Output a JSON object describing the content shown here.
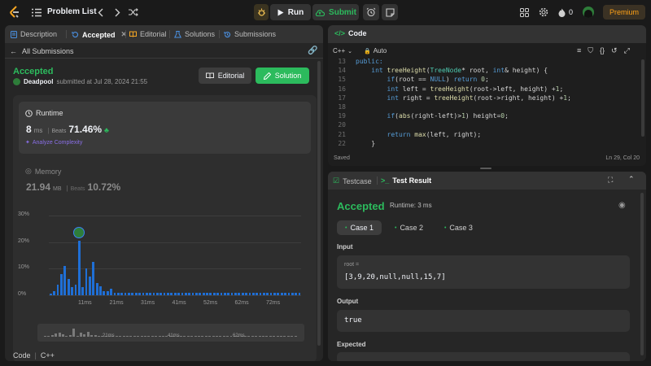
{
  "topbar": {
    "problem_list": "Problem List",
    "run": "Run",
    "submit": "Submit",
    "streak": "0",
    "premium": "Premium"
  },
  "left": {
    "tabs": [
      {
        "label": "Description"
      },
      {
        "label": "Accepted"
      },
      {
        "label": "Editorial"
      },
      {
        "label": "Solutions"
      },
      {
        "label": "Submissions"
      }
    ],
    "back": "All Submissions",
    "status": "Accepted",
    "user": "Deadpool",
    "submitted": "submitted at Jul 28, 2024 21:55",
    "editorial_btn": "Editorial",
    "solution_btn": "Solution",
    "runtime": {
      "title": "Runtime",
      "value": "8",
      "unit": "ms",
      "beats_label": "Beats",
      "beats": "71.46%",
      "analyze": "Analyze Complexity"
    },
    "memory": {
      "title": "Memory",
      "value": "21.94",
      "unit": "MB",
      "beats_label": "Beats",
      "beats": "10.72%"
    },
    "code_footer": {
      "code": "Code",
      "lang": "C++"
    }
  },
  "chart_data": {
    "type": "bar",
    "y_ticks": [
      "30%",
      "20%",
      "10%",
      "0%"
    ],
    "ylim": [
      0,
      30
    ],
    "x_ticks": [
      "11ms",
      "21ms",
      "31ms",
      "41ms",
      "52ms",
      "62ms",
      "72ms"
    ],
    "values": [
      0.5,
      1.5,
      4,
      8,
      11,
      6,
      3,
      4,
      20.5,
      3,
      10,
      7,
      12.5,
      4.5,
      3.5,
      1.5,
      1.5,
      2.5,
      1,
      1,
      1,
      1,
      1,
      1,
      1,
      1,
      1,
      1,
      1,
      1,
      1,
      1,
      1,
      1,
      1,
      1,
      1,
      1,
      1,
      1,
      1,
      1,
      1,
      1,
      1,
      1,
      1,
      1,
      1,
      1,
      1,
      1,
      1,
      1,
      1,
      1,
      1,
      1,
      1,
      1,
      1,
      1,
      1,
      1,
      1,
      1,
      1,
      1,
      1,
      1,
      1
    ],
    "highlight_index": 8,
    "range_ticks": [
      "21ms",
      "41ms",
      "62ms"
    ]
  },
  "code": {
    "title": "Code",
    "lang": "C++",
    "mode": "Auto",
    "saved": "Saved",
    "cursor": "Ln 29, Col 20",
    "lines": [
      {
        "n": "13",
        "segs": [
          {
            "t": "public:",
            "c": "kw"
          }
        ]
      },
      {
        "n": "14",
        "segs": [
          {
            "t": "    ",
            "c": "tx"
          },
          {
            "t": "int",
            "c": "kw"
          },
          {
            "t": " ",
            "c": "tx"
          },
          {
            "t": "treeHeight",
            "c": "fn"
          },
          {
            "t": "(",
            "c": "tx"
          },
          {
            "t": "TreeNode",
            "c": "ty"
          },
          {
            "t": "* root, ",
            "c": "tx"
          },
          {
            "t": "int",
            "c": "kw"
          },
          {
            "t": "& height) {",
            "c": "tx"
          }
        ]
      },
      {
        "n": "15",
        "segs": [
          {
            "t": "        ",
            "c": "tx"
          },
          {
            "t": "if",
            "c": "kw"
          },
          {
            "t": "(root == ",
            "c": "tx"
          },
          {
            "t": "NULL",
            "c": "kw"
          },
          {
            "t": ") ",
            "c": "tx"
          },
          {
            "t": "return",
            "c": "kw"
          },
          {
            "t": " ",
            "c": "tx"
          },
          {
            "t": "0",
            "c": "nm"
          },
          {
            "t": ";",
            "c": "tx"
          }
        ]
      },
      {
        "n": "16",
        "segs": [
          {
            "t": "        ",
            "c": "tx"
          },
          {
            "t": "int",
            "c": "kw"
          },
          {
            "t": " left = ",
            "c": "tx"
          },
          {
            "t": "treeHeight",
            "c": "fn"
          },
          {
            "t": "(root->left, height) +",
            "c": "tx"
          },
          {
            "t": "1",
            "c": "nm"
          },
          {
            "t": ";",
            "c": "tx"
          }
        ]
      },
      {
        "n": "17",
        "segs": [
          {
            "t": "        ",
            "c": "tx"
          },
          {
            "t": "int",
            "c": "kw"
          },
          {
            "t": " right = ",
            "c": "tx"
          },
          {
            "t": "treeHeight",
            "c": "fn"
          },
          {
            "t": "(root->right, height) +",
            "c": "tx"
          },
          {
            "t": "1",
            "c": "nm"
          },
          {
            "t": ";",
            "c": "tx"
          }
        ]
      },
      {
        "n": "18",
        "segs": []
      },
      {
        "n": "19",
        "segs": [
          {
            "t": "        ",
            "c": "tx"
          },
          {
            "t": "if",
            "c": "kw"
          },
          {
            "t": "(",
            "c": "tx"
          },
          {
            "t": "abs",
            "c": "fn"
          },
          {
            "t": "(right-left)>",
            "c": "tx"
          },
          {
            "t": "1",
            "c": "nm"
          },
          {
            "t": ") height=",
            "c": "tx"
          },
          {
            "t": "0",
            "c": "nm"
          },
          {
            "t": ";",
            "c": "tx"
          }
        ]
      },
      {
        "n": "20",
        "segs": []
      },
      {
        "n": "21",
        "segs": [
          {
            "t": "        ",
            "c": "tx"
          },
          {
            "t": "return",
            "c": "kw"
          },
          {
            "t": " ",
            "c": "tx"
          },
          {
            "t": "max",
            "c": "fn"
          },
          {
            "t": "(left, right);",
            "c": "tx"
          }
        ]
      },
      {
        "n": "22",
        "segs": [
          {
            "t": "    }",
            "c": "tx"
          }
        ]
      }
    ]
  },
  "testpanel": {
    "tab_testcase": "Testcase",
    "tab_result": "Test Result",
    "status": "Accepted",
    "runtime": "Runtime: 3 ms",
    "cases": [
      {
        "label": "Case 1"
      },
      {
        "label": "Case 2"
      },
      {
        "label": "Case 3"
      }
    ],
    "input_label": "Input",
    "var_name": "root =",
    "var_value": "[3,9,20,null,null,15,7]",
    "output_label": "Output",
    "output_value": "true",
    "expected_label": "Expected"
  }
}
